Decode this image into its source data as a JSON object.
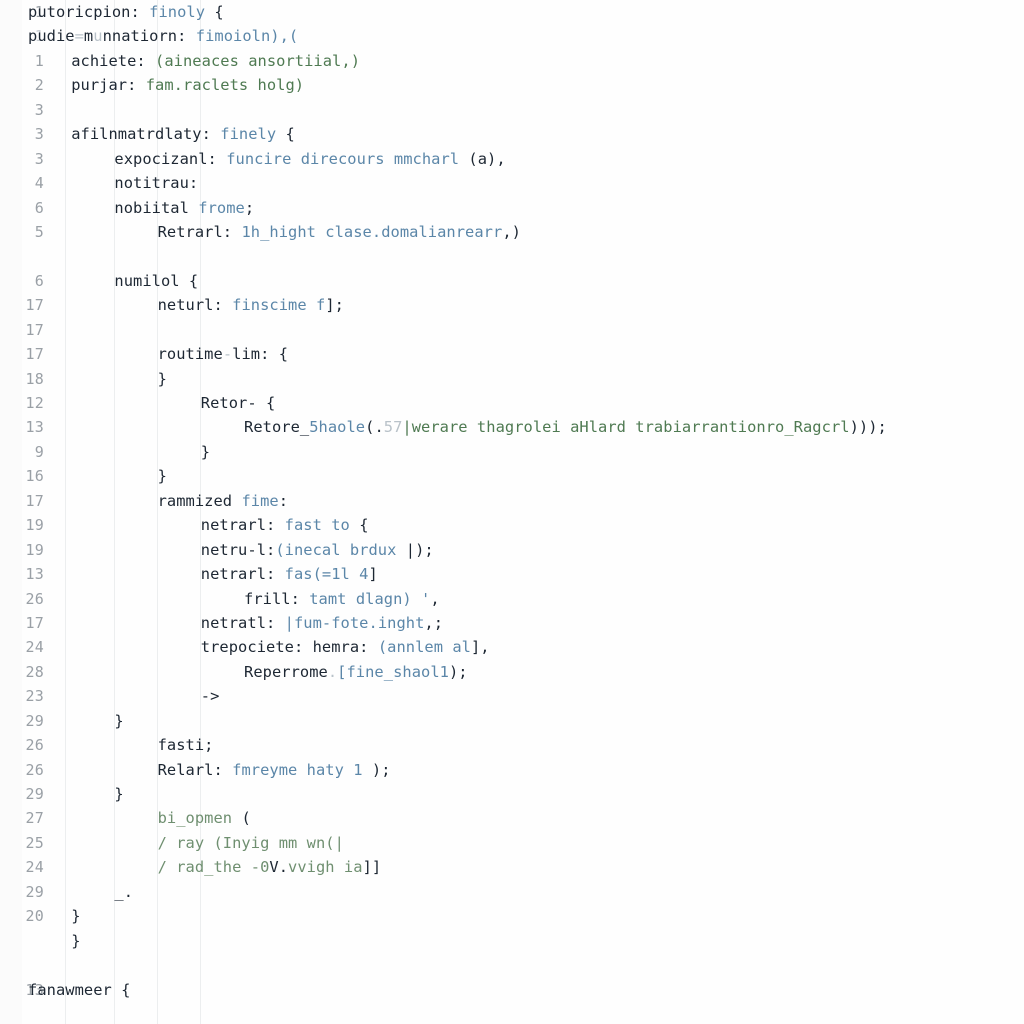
{
  "editor": {
    "name": "code-editor-pane",
    "background_color": "#fefefe",
    "gutter_color": "#fbfbfb",
    "colors": {
      "plain_text": "#1d2733",
      "keyword": "#5b86a8",
      "string": "#4f7a52",
      "comment": "#6f8f70",
      "line_number": "#9aa0a6",
      "indent_guide": "#eceeef"
    },
    "lines": [
      {
        "number": "1",
        "dim": false,
        "indent": 0,
        "tokens": [
          {
            "text": "putoricpion:",
            "k": "plain"
          },
          {
            "text": " ",
            "k": "plain"
          },
          {
            "text": "finoly",
            "k": "kw"
          },
          {
            "text": " {",
            "k": "punc"
          }
        ]
      },
      {
        "number": "1",
        "dim": true,
        "indent": 0,
        "tokens": [
          {
            "text": "pudie",
            "k": "plain"
          },
          {
            "text": "=",
            "k": "faint"
          },
          {
            "text": "m",
            "k": "plain"
          },
          {
            "text": "u",
            "k": "faint"
          },
          {
            "text": "nnatiorn:",
            "k": "plain"
          },
          {
            "text": " ",
            "k": "plain"
          },
          {
            "text": "fimoioln),(",
            "k": "kw"
          }
        ]
      },
      {
        "number": "1",
        "dim": false,
        "indent": 1,
        "tokens": [
          {
            "text": "achiete:",
            "k": "plain"
          },
          {
            "text": " ",
            "k": "plain"
          },
          {
            "text": "(aineaces ansortiial,",
            "k": "str"
          },
          {
            "text": ")",
            "k": "str"
          }
        ]
      },
      {
        "number": "2",
        "dim": false,
        "indent": 1,
        "tokens": [
          {
            "text": "purjar:",
            "k": "plain"
          },
          {
            "text": " ",
            "k": "plain"
          },
          {
            "text": "fam.raclets holg)",
            "k": "str"
          }
        ]
      },
      {
        "number": "3",
        "dim": false,
        "indent": 0,
        "tokens": []
      },
      {
        "number": "3",
        "dim": false,
        "indent": 1,
        "tokens": [
          {
            "text": "afilnmatrdlaty:",
            "k": "plain"
          },
          {
            "text": " ",
            "k": "plain"
          },
          {
            "text": "finely",
            "k": "kw"
          },
          {
            "text": " {",
            "k": "punc"
          }
        ]
      },
      {
        "number": "3",
        "dim": false,
        "indent": 2,
        "tokens": [
          {
            "text": "expocizanl:",
            "k": "plain"
          },
          {
            "text": " ",
            "k": "plain"
          },
          {
            "text": "funcire direcours mmcharl",
            "k": "kw"
          },
          {
            "text": " (a)",
            "k": "plain"
          },
          {
            "text": ",",
            "k": "punc"
          }
        ]
      },
      {
        "number": "4",
        "dim": false,
        "indent": 2,
        "tokens": [
          {
            "text": "notitrau:",
            "k": "plain"
          }
        ]
      },
      {
        "number": "6",
        "dim": false,
        "indent": 2,
        "tokens": [
          {
            "text": "nobiital",
            "k": "plain"
          },
          {
            "text": " ",
            "k": "plain"
          },
          {
            "text": "frome",
            "k": "kw"
          },
          {
            "text": ";",
            "k": "punc"
          }
        ]
      },
      {
        "number": "5",
        "dim": false,
        "indent": 3,
        "tokens": [
          {
            "text": "Retrarl:",
            "k": "plain"
          },
          {
            "text": " ",
            "k": "plain"
          },
          {
            "text": "1h_hight clase.domalianrearr",
            "k": "kw"
          },
          {
            "text": ",)",
            "k": "punc"
          }
        ]
      },
      {
        "number": "",
        "dim": false,
        "indent": 0,
        "tokens": []
      },
      {
        "number": "6",
        "dim": false,
        "indent": 2,
        "tokens": [
          {
            "text": "numilol",
            "k": "plain"
          },
          {
            "text": " {",
            "k": "punc"
          }
        ]
      },
      {
        "number": "17",
        "dim": false,
        "indent": 3,
        "tokens": [
          {
            "text": "neturl:",
            "k": "plain"
          },
          {
            "text": " ",
            "k": "plain"
          },
          {
            "text": "finscime f",
            "k": "kw"
          },
          {
            "text": "];",
            "k": "punc"
          }
        ]
      },
      {
        "number": "17",
        "dim": false,
        "indent": 0,
        "tokens": []
      },
      {
        "number": "17",
        "dim": false,
        "indent": 3,
        "tokens": [
          {
            "text": "routime",
            "k": "plain"
          },
          {
            "text": "-",
            "k": "faint"
          },
          {
            "text": "lim:",
            "k": "plain"
          },
          {
            "text": " {",
            "k": "punc"
          }
        ]
      },
      {
        "number": "18",
        "dim": false,
        "indent": 3,
        "tokens": [
          {
            "text": "}",
            "k": "punc"
          }
        ]
      },
      {
        "number": "12",
        "dim": false,
        "indent": 4,
        "tokens": [
          {
            "text": "Retor-",
            "k": "plain"
          },
          {
            "text": " {",
            "k": "punc"
          }
        ]
      },
      {
        "number": "13",
        "dim": false,
        "indent": 5,
        "tokens": [
          {
            "text": "Retore_",
            "k": "plain"
          },
          {
            "text": "5haole",
            "k": "kw"
          },
          {
            "text": "(.",
            "k": "punc"
          },
          {
            "text": "57",
            "k": "faint"
          },
          {
            "text": "|werare thagrolei aHlard trabiarrantionro_Ragcrl",
            "k": "str"
          },
          {
            "text": ")));",
            "k": "punc"
          }
        ]
      },
      {
        "number": "9",
        "dim": false,
        "indent": 4,
        "tokens": [
          {
            "text": "}",
            "k": "punc"
          }
        ]
      },
      {
        "number": "16",
        "dim": false,
        "indent": 3,
        "tokens": [
          {
            "text": "}",
            "k": "punc"
          }
        ]
      },
      {
        "number": "17",
        "dim": false,
        "indent": 3,
        "tokens": [
          {
            "text": "rammized",
            "k": "plain"
          },
          {
            "text": " ",
            "k": "plain"
          },
          {
            "text": "fime",
            "k": "kw"
          },
          {
            "text": ":",
            "k": "punc"
          }
        ]
      },
      {
        "number": "19",
        "dim": false,
        "indent": 4,
        "tokens": [
          {
            "text": "netrarl:",
            "k": "plain"
          },
          {
            "text": " ",
            "k": "plain"
          },
          {
            "text": "fast to",
            "k": "kw"
          },
          {
            "text": " {",
            "k": "punc"
          }
        ]
      },
      {
        "number": "19",
        "dim": false,
        "indent": 4,
        "tokens": [
          {
            "text": "netru-l:",
            "k": "plain"
          },
          {
            "text": "(inecal brdux ",
            "k": "kw"
          },
          {
            "text": "|);",
            "k": "punc"
          }
        ]
      },
      {
        "number": "13",
        "dim": false,
        "indent": 4,
        "tokens": [
          {
            "text": "netrarl:",
            "k": "plain"
          },
          {
            "text": " ",
            "k": "plain"
          },
          {
            "text": "fas(=1l 4",
            "k": "kw"
          },
          {
            "text": "]",
            "k": "punc"
          }
        ]
      },
      {
        "number": "26",
        "dim": false,
        "indent": 5,
        "tokens": [
          {
            "text": "frill:",
            "k": "plain"
          },
          {
            "text": " ",
            "k": "plain"
          },
          {
            "text": "tamt dlagn) '",
            "k": "kw"
          },
          {
            "text": ",",
            "k": "punc"
          }
        ]
      },
      {
        "number": "17",
        "dim": false,
        "indent": 4,
        "tokens": [
          {
            "text": "netratl:",
            "k": "plain"
          },
          {
            "text": " ",
            "k": "plain"
          },
          {
            "text": "|fum-fote.inght",
            "k": "kw"
          },
          {
            "text": ",;",
            "k": "punc"
          }
        ]
      },
      {
        "number": "24",
        "dim": false,
        "indent": 4,
        "tokens": [
          {
            "text": "trepociete: hemra:",
            "k": "plain"
          },
          {
            "text": " ",
            "k": "plain"
          },
          {
            "text": "(annlem al",
            "k": "kw"
          },
          {
            "text": "],",
            "k": "punc"
          }
        ]
      },
      {
        "number": "28",
        "dim": false,
        "indent": 5,
        "tokens": [
          {
            "text": "Reperrome",
            "k": "plain"
          },
          {
            "text": ".",
            "k": "faint"
          },
          {
            "text": "[fine_shaol1",
            "k": "kw"
          },
          {
            "text": ");",
            "k": "punc"
          }
        ]
      },
      {
        "number": "23",
        "dim": false,
        "indent": 4,
        "tokens": [
          {
            "text": "->",
            "k": "plain"
          }
        ]
      },
      {
        "number": "29",
        "dim": false,
        "indent": 2,
        "tokens": [
          {
            "text": "}",
            "k": "punc"
          }
        ]
      },
      {
        "number": "26",
        "dim": false,
        "indent": 3,
        "tokens": [
          {
            "text": "fasti;",
            "k": "plain"
          }
        ]
      },
      {
        "number": "26",
        "dim": false,
        "indent": 3,
        "tokens": [
          {
            "text": "Relarl:",
            "k": "plain"
          },
          {
            "text": " ",
            "k": "plain"
          },
          {
            "text": "fmreyme haty",
            "k": "kw"
          },
          {
            "text": " ",
            "k": "plain"
          },
          {
            "text": "1",
            "k": "num"
          },
          {
            "text": " );",
            "k": "punc"
          }
        ]
      },
      {
        "number": "29",
        "dim": false,
        "indent": 2,
        "tokens": [
          {
            "text": "}",
            "k": "punc"
          }
        ]
      },
      {
        "number": "27",
        "dim": false,
        "indent": 3,
        "tokens": [
          {
            "text": "bi_opmen",
            "k": "cmt"
          },
          {
            "text": " (",
            "k": "punc"
          }
        ]
      },
      {
        "number": "25",
        "dim": false,
        "indent": 3,
        "tokens": [
          {
            "text": "/ ray (Inyig mm wn(|",
            "k": "cmt"
          }
        ]
      },
      {
        "number": "24",
        "dim": false,
        "indent": 3,
        "tokens": [
          {
            "text": "/ rad_the -0",
            "k": "cmt"
          },
          {
            "text": "V.",
            "k": "plain"
          },
          {
            "text": "vvigh ia",
            "k": "cmt"
          },
          {
            "text": "]]",
            "k": "punc"
          }
        ]
      },
      {
        "number": "29",
        "dim": false,
        "indent": 2,
        "tokens": [
          {
            "text": "_.",
            "k": "plain"
          }
        ]
      },
      {
        "number": "20",
        "dim": false,
        "indent": 1,
        "tokens": [
          {
            "text": "}",
            "k": "punc"
          }
        ]
      },
      {
        "number": "",
        "dim": false,
        "indent": 1,
        "tokens": [
          {
            "text": "}",
            "k": "punc"
          }
        ]
      },
      {
        "number": "",
        "dim": false,
        "indent": 0,
        "tokens": []
      },
      {
        "number": "13",
        "dim": false,
        "indent": 0,
        "tokens": [
          {
            "text": "fanawmeer",
            "k": "plain"
          },
          {
            "text": " {",
            "k": "punc"
          }
        ]
      }
    ],
    "indent_guide_positions": [
      65,
      114,
      157,
      200
    ]
  }
}
